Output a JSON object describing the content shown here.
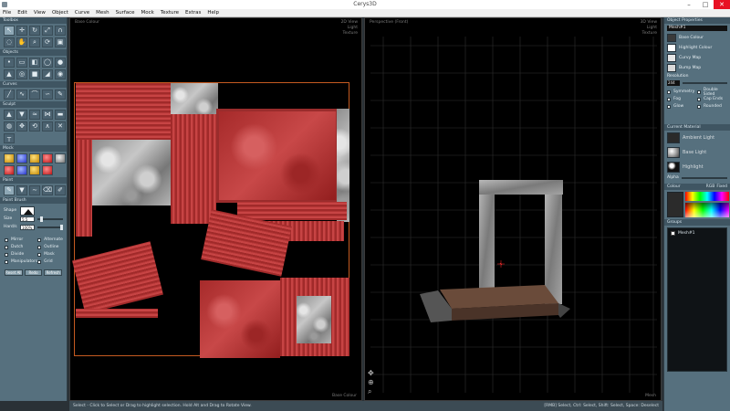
{
  "window": {
    "title": "Cerys3D",
    "minimize": "–",
    "maximize": "□",
    "close": "✕"
  },
  "menu": [
    "File",
    "Edit",
    "View",
    "Object",
    "Curve",
    "Mesh",
    "Surface",
    "Mock",
    "Texture",
    "Extras",
    "Help"
  ],
  "toolbar": {
    "header": "Toolbox",
    "objects_header": "Objects",
    "curves_header": "Curves",
    "sculpt_header": "Sculpt",
    "mock_header": "Mock",
    "paint_header": "Paint"
  },
  "brush": {
    "header": "Paint Brush",
    "shape_label": "Shape",
    "size_label": "Size",
    "size_value": "5.5",
    "hardness_label": "Hard/s",
    "hardness_value": "100%",
    "options": [
      "Mirror",
      "Alternate",
      "Dutch",
      "Outline",
      "Divide",
      "Mask",
      "Manipulators",
      "Grid"
    ],
    "buttons": [
      "Reset All",
      "Redo",
      "Refresh"
    ]
  },
  "viewport_left": {
    "title": "Base Colour",
    "labels": [
      "2D View",
      "Light",
      "Texture"
    ],
    "footer": "Base Colour"
  },
  "viewport_right": {
    "title": "Perspective (Front)",
    "labels": [
      "3D View",
      "Light",
      "Texture"
    ],
    "footer": "Mesh"
  },
  "props": {
    "header": "Object Properties",
    "name": "Mesh#1",
    "base_colour": "Base Colour",
    "highlight_colour": "Highlight Colour",
    "curvy_map": "Curvy Map",
    "bump_map": "Bump Map",
    "resolution_label": "Resolution",
    "resolution_value": "244",
    "toggles": [
      "Symmetry",
      "Double Sided",
      "Fog",
      "Cap Ends",
      "Glow",
      "Rounded"
    ],
    "material_header": "Current Material",
    "ambient": "Ambient Light",
    "base_light": "Base Light",
    "highlight": "Highlight",
    "alpha_label": "Alpha",
    "colour_header": "Colour",
    "tabs": [
      "RGB",
      "Fixed"
    ],
    "groups_header": "Groups",
    "group_item": "Mesh#1"
  },
  "status": {
    "left": "Select - Click to Select or Drag to highlight selection. Hold Alt and Drag to Rotate View.",
    "right": "[RMB] Select,  Ctrl: Select,  Shift: Select,  Space: Deselect"
  }
}
